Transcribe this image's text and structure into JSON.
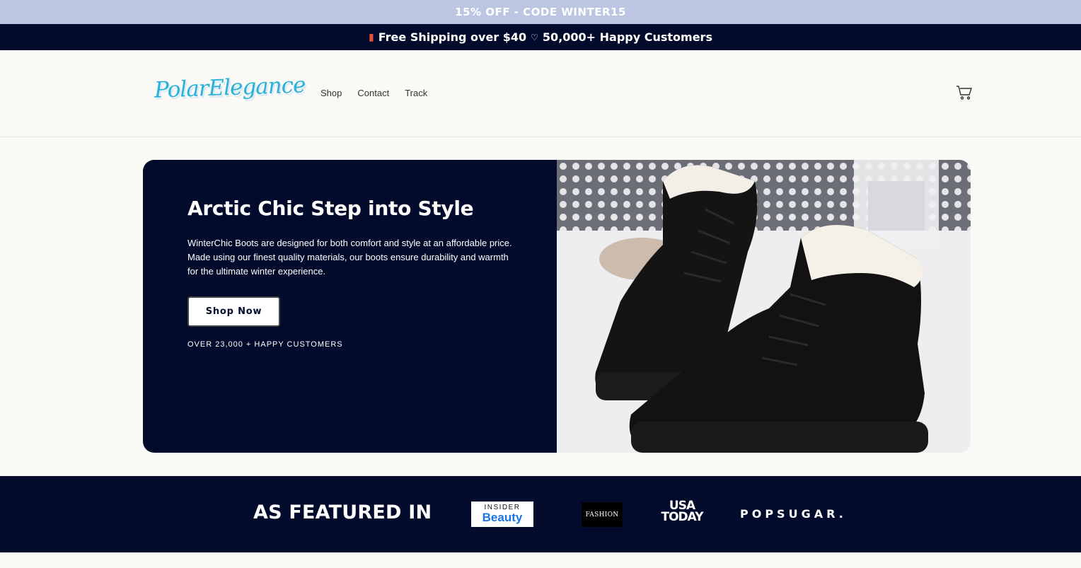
{
  "promo": {
    "text": "15% OFF - CODE WINTER15"
  },
  "shipping": {
    "truck_icon": "truck-icon",
    "left": "Free Shipping over $40",
    "heart_icon": "heart-icon",
    "right": "50,000+ Happy Customers"
  },
  "header": {
    "logo": "PolarElegance",
    "nav": [
      {
        "label": "Shop"
      },
      {
        "label": "Contact"
      },
      {
        "label": "Track"
      }
    ],
    "cart_icon": "cart-icon"
  },
  "hero": {
    "title": "Arctic Chic Step into Style",
    "description": "WinterChic Boots are designed for both comfort and style at an affordable price. Made using our finest quality materials, our boots ensure durability and warmth for the ultimate winter experience.",
    "button": "Shop Now",
    "subtext": "OVER 23,000 + HAPPY CUSTOMERS",
    "image": "black-winter-boots-in-snow"
  },
  "featured": {
    "title": "AS FEATURED IN",
    "insider_top": "INSIDER",
    "insider_bottom": "Beauty",
    "fashion": "FASHION",
    "usa_line1": "USA",
    "usa_line2": "TODAY",
    "popsugar": "POPSUGAR."
  },
  "colors": {
    "navy": "#020b2c",
    "promo_bg": "#bcc6e3",
    "logo_blue": "#2bb1d8",
    "page_bg": "#faf9f6"
  }
}
